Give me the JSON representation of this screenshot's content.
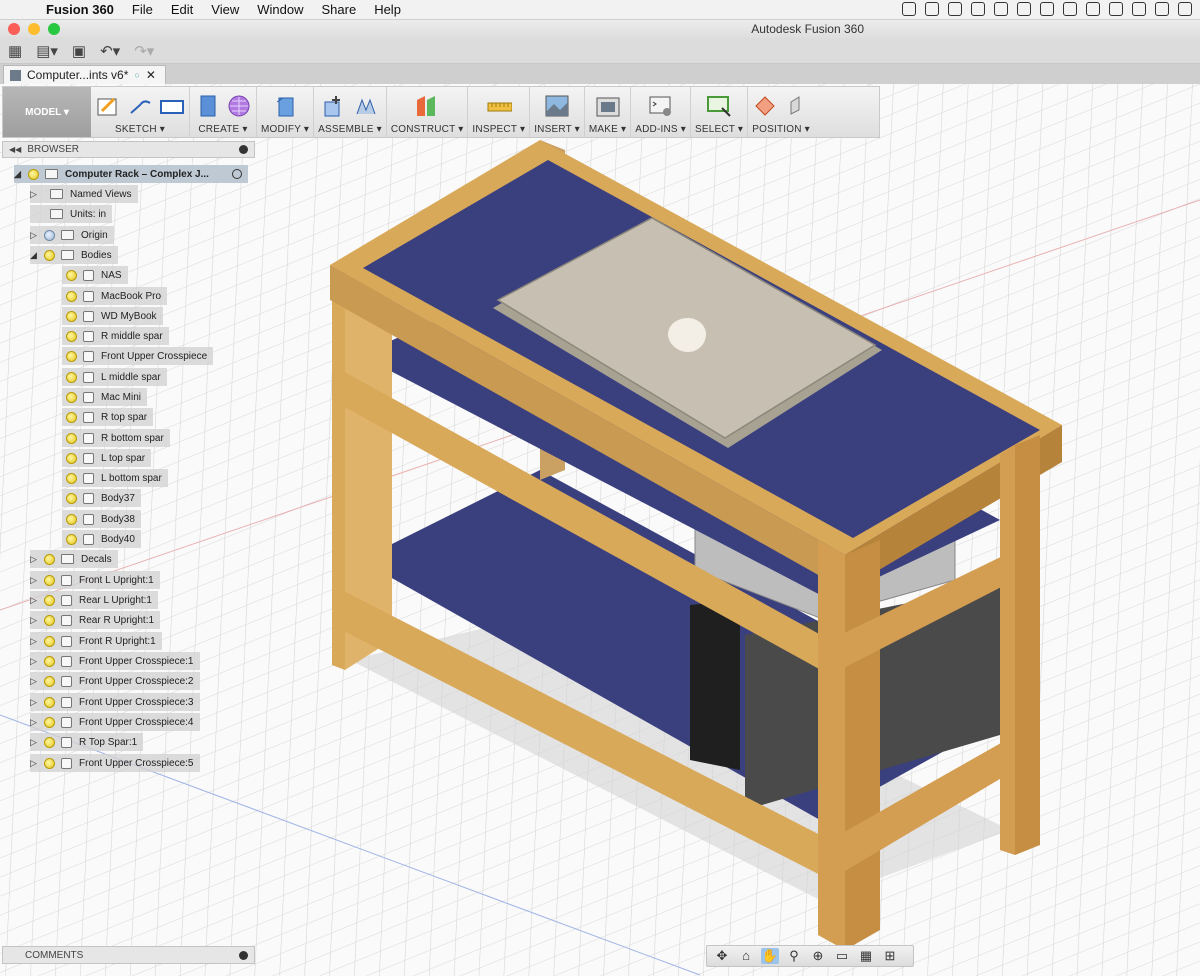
{
  "menubar": {
    "app_name": "Fusion 360",
    "items": [
      "File",
      "Edit",
      "View",
      "Window",
      "Share",
      "Help"
    ]
  },
  "window": {
    "title": "Autodesk Fusion 360"
  },
  "document_tab": {
    "label": "Computer...ints v6*"
  },
  "toolbar": {
    "workspace": "MODEL ▾",
    "groups": [
      "SKETCH ▾",
      "CREATE ▾",
      "MODIFY ▾",
      "ASSEMBLE ▾",
      "CONSTRUCT ▾",
      "INSPECT ▾",
      "INSERT ▾",
      "MAKE ▾",
      "ADD-INS ▾",
      "SELECT ▾",
      "POSITION ▾"
    ]
  },
  "browser": {
    "title": "BROWSER",
    "root": "Computer Rack – Complex J...",
    "items": [
      {
        "label": "Named Views"
      },
      {
        "label": "Units: in"
      },
      {
        "label": "Origin"
      },
      {
        "label": "Bodies"
      },
      {
        "label": "NAS"
      },
      {
        "label": "MacBook Pro"
      },
      {
        "label": "WD MyBook"
      },
      {
        "label": "R middle spar"
      },
      {
        "label": "Front Upper Crosspiece"
      },
      {
        "label": "L middle spar"
      },
      {
        "label": "Mac Mini"
      },
      {
        "label": "R top spar"
      },
      {
        "label": "R bottom spar"
      },
      {
        "label": "L top spar"
      },
      {
        "label": "L bottom spar"
      },
      {
        "label": "Body37"
      },
      {
        "label": "Body38"
      },
      {
        "label": "Body40"
      },
      {
        "label": "Decals"
      },
      {
        "label": "Front L Upright:1"
      },
      {
        "label": "Rear L Upright:1"
      },
      {
        "label": "Rear R Upright:1"
      },
      {
        "label": "Front R Upright:1"
      },
      {
        "label": "Front Upper Crosspiece:1"
      },
      {
        "label": "Front Upper Crosspiece:2"
      },
      {
        "label": "Front Upper Crosspiece:3"
      },
      {
        "label": "Front Upper Crosspiece:4"
      },
      {
        "label": "R Top Spar:1"
      },
      {
        "label": "Front Upper Crosspiece:5"
      }
    ]
  },
  "comments": {
    "title": "COMMENTS"
  },
  "colors": {
    "wood": "#d9a95a",
    "wood_dark": "#b6833b",
    "shelf": "#3a3f7e",
    "laptop": "#c7c0b2"
  }
}
